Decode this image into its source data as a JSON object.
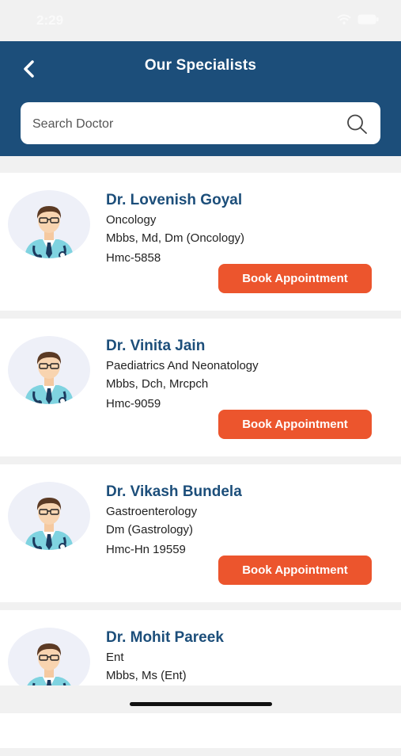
{
  "status_bar": {
    "time": "2:29"
  },
  "header": {
    "title": "Our Specialists"
  },
  "search": {
    "placeholder": "Search Doctor",
    "value": ""
  },
  "doctors": [
    {
      "name": "Dr. Lovenish Goyal",
      "specialty": "Oncology",
      "qualification": "Mbbs, Md, Dm (Oncology)",
      "registration": "Hmc-5858",
      "button": "Book Appointment"
    },
    {
      "name": "Dr. Vinita Jain",
      "specialty": "Paediatrics And Neonatology",
      "qualification": "Mbbs, Dch, Mrcpch",
      "registration": "Hmc-9059",
      "button": "Book Appointment"
    },
    {
      "name": "Dr. Vikash Bundela",
      "specialty": "Gastroenterology",
      "qualification": "Dm (Gastrology)",
      "registration": "Hmc-Hn 19559",
      "button": "Book Appointment"
    },
    {
      "name": "Dr. Mohit Pareek",
      "specialty": "Ent",
      "qualification": "Mbbs, Ms (Ent)",
      "registration": "",
      "button": ""
    }
  ],
  "colors": {
    "header": "#1c4e7a",
    "accent_button": "#ec552d",
    "name_text": "#1c4e7a"
  },
  "icons": {
    "back": "chevron-left-icon",
    "search": "search-icon",
    "avatar": "doctor-avatar-icon"
  }
}
